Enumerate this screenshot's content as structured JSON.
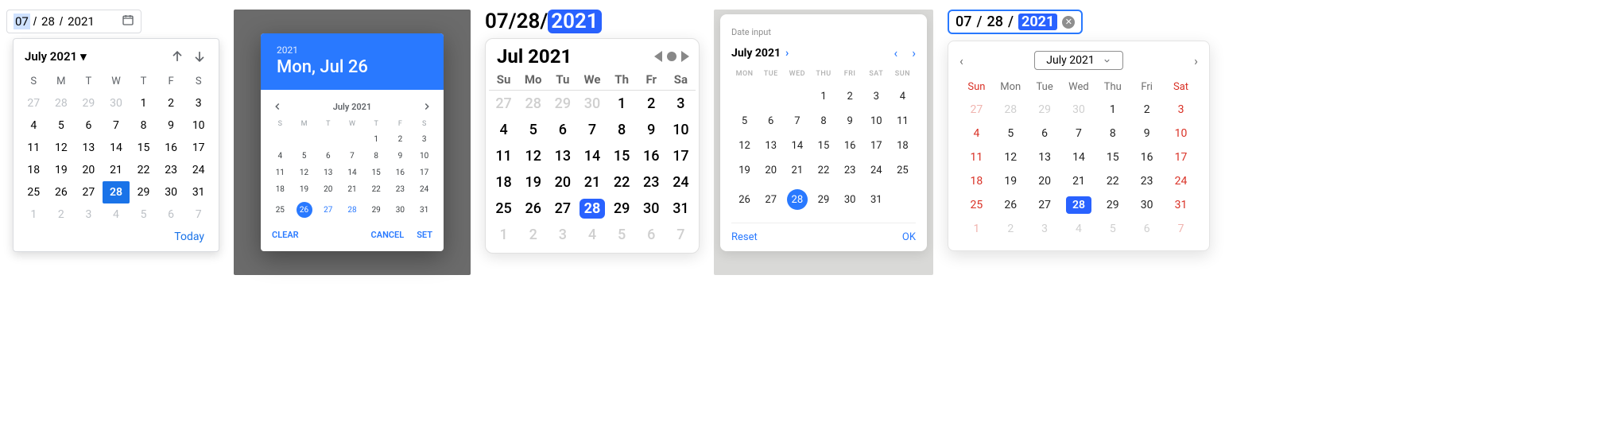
{
  "p1": {
    "input": {
      "mm": "07",
      "dd": "28",
      "yyyy": "2021"
    },
    "title": "July 2021",
    "dow": [
      "S",
      "M",
      "T",
      "W",
      "T",
      "F",
      "S"
    ],
    "weeks": [
      [
        {
          "n": 27,
          "out": true
        },
        {
          "n": 28,
          "out": true
        },
        {
          "n": 29,
          "out": true
        },
        {
          "n": 30,
          "out": true
        },
        {
          "n": 1
        },
        {
          "n": 2
        },
        {
          "n": 3
        }
      ],
      [
        {
          "n": 4
        },
        {
          "n": 5
        },
        {
          "n": 6
        },
        {
          "n": 7
        },
        {
          "n": 8
        },
        {
          "n": 9
        },
        {
          "n": 10
        }
      ],
      [
        {
          "n": 11
        },
        {
          "n": 12
        },
        {
          "n": 13
        },
        {
          "n": 14
        },
        {
          "n": 15
        },
        {
          "n": 16
        },
        {
          "n": 17
        }
      ],
      [
        {
          "n": 18
        },
        {
          "n": 19
        },
        {
          "n": 20
        },
        {
          "n": 21
        },
        {
          "n": 22
        },
        {
          "n": 23
        },
        {
          "n": 24
        }
      ],
      [
        {
          "n": 25
        },
        {
          "n": 26
        },
        {
          "n": 27
        },
        {
          "n": 28,
          "sel": true
        },
        {
          "n": 29
        },
        {
          "n": 30
        },
        {
          "n": 31
        }
      ],
      [
        {
          "n": 1,
          "out": true
        },
        {
          "n": 2,
          "out": true
        },
        {
          "n": 3,
          "out": true
        },
        {
          "n": 4,
          "out": true
        },
        {
          "n": 5,
          "out": true
        },
        {
          "n": 6,
          "out": true
        },
        {
          "n": 7,
          "out": true
        }
      ]
    ],
    "today": "Today"
  },
  "p2": {
    "year": "2021",
    "date": "Mon, Jul 26",
    "month": "July 2021",
    "dow": [
      "S",
      "M",
      "T",
      "W",
      "T",
      "F",
      "S"
    ],
    "weeks": [
      [
        {
          "n": ""
        },
        {
          "n": ""
        },
        {
          "n": ""
        },
        {
          "n": ""
        },
        {
          "n": 1
        },
        {
          "n": 2
        },
        {
          "n": 3
        }
      ],
      [
        {
          "n": 4
        },
        {
          "n": 5
        },
        {
          "n": 6
        },
        {
          "n": 7
        },
        {
          "n": 8
        },
        {
          "n": 9
        },
        {
          "n": 10
        }
      ],
      [
        {
          "n": 11
        },
        {
          "n": 12
        },
        {
          "n": 13
        },
        {
          "n": 14
        },
        {
          "n": 15
        },
        {
          "n": 16
        },
        {
          "n": 17
        }
      ],
      [
        {
          "n": 18
        },
        {
          "n": 19
        },
        {
          "n": 20
        },
        {
          "n": 21
        },
        {
          "n": 22
        },
        {
          "n": 23
        },
        {
          "n": 24
        }
      ],
      [
        {
          "n": 25
        },
        {
          "n": 26,
          "sel": true
        },
        {
          "n": 27,
          "link": true
        },
        {
          "n": 28,
          "link": true
        },
        {
          "n": 29
        },
        {
          "n": 30
        },
        {
          "n": 31
        }
      ]
    ],
    "actions": {
      "clear": "CLEAR",
      "cancel": "CANCEL",
      "set": "SET"
    }
  },
  "p3": {
    "input": {
      "mm": "07",
      "dd": "28",
      "yyyy": "2021"
    },
    "title": "Jul 2021",
    "dow": [
      "Su",
      "Mo",
      "Tu",
      "We",
      "Th",
      "Fr",
      "Sa"
    ],
    "weeks": [
      [
        {
          "n": 27,
          "out": true
        },
        {
          "n": 28,
          "out": true
        },
        {
          "n": 29,
          "out": true
        },
        {
          "n": 30,
          "out": true
        },
        {
          "n": 1
        },
        {
          "n": 2
        },
        {
          "n": 3
        }
      ],
      [
        {
          "n": 4
        },
        {
          "n": 5
        },
        {
          "n": 6
        },
        {
          "n": 7
        },
        {
          "n": 8
        },
        {
          "n": 9
        },
        {
          "n": 10
        }
      ],
      [
        {
          "n": 11
        },
        {
          "n": 12
        },
        {
          "n": 13
        },
        {
          "n": 14
        },
        {
          "n": 15
        },
        {
          "n": 16
        },
        {
          "n": 17
        }
      ],
      [
        {
          "n": 18
        },
        {
          "n": 19
        },
        {
          "n": 20
        },
        {
          "n": 21
        },
        {
          "n": 22
        },
        {
          "n": 23
        },
        {
          "n": 24
        }
      ],
      [
        {
          "n": 25
        },
        {
          "n": 26
        },
        {
          "n": 27
        },
        {
          "n": 28,
          "sel": true
        },
        {
          "n": 29
        },
        {
          "n": 30
        },
        {
          "n": 31
        }
      ],
      [
        {
          "n": 1,
          "out": true
        },
        {
          "n": 2,
          "out": true
        },
        {
          "n": 3,
          "out": true
        },
        {
          "n": 4,
          "out": true
        },
        {
          "n": 5,
          "out": true
        },
        {
          "n": 6,
          "out": true
        },
        {
          "n": 7,
          "out": true
        }
      ]
    ]
  },
  "p4": {
    "label": "Date input",
    "title": "July 2021",
    "dow": [
      "MON",
      "TUE",
      "WED",
      "THU",
      "FRI",
      "SAT",
      "SUN"
    ],
    "weeks": [
      [
        {
          "n": ""
        },
        {
          "n": ""
        },
        {
          "n": ""
        },
        {
          "n": 1
        },
        {
          "n": 2
        },
        {
          "n": 3
        },
        {
          "n": 4
        }
      ],
      [
        {
          "n": 5
        },
        {
          "n": 6
        },
        {
          "n": 7
        },
        {
          "n": 8
        },
        {
          "n": 9
        },
        {
          "n": 10
        },
        {
          "n": 11
        }
      ],
      [
        {
          "n": 12
        },
        {
          "n": 13
        },
        {
          "n": 14
        },
        {
          "n": 15
        },
        {
          "n": 16
        },
        {
          "n": 17
        },
        {
          "n": 18
        }
      ],
      [
        {
          "n": 19
        },
        {
          "n": 20
        },
        {
          "n": 21
        },
        {
          "n": 22
        },
        {
          "n": 23
        },
        {
          "n": 24
        },
        {
          "n": 25
        }
      ],
      [
        {
          "n": 26
        },
        {
          "n": 27
        },
        {
          "n": 28,
          "sel": true
        },
        {
          "n": 29
        },
        {
          "n": 30
        },
        {
          "n": 31
        },
        {
          "n": ""
        }
      ]
    ],
    "actions": {
      "reset": "Reset",
      "ok": "OK"
    }
  },
  "p5": {
    "input": {
      "mm": "07",
      "dd": "28",
      "yyyy": "2021"
    },
    "title": "July 2021",
    "dow": [
      "Sun",
      "Mon",
      "Tue",
      "Wed",
      "Thu",
      "Fri",
      "Sat"
    ],
    "weeks": [
      [
        {
          "n": 27,
          "out": true,
          "off": true
        },
        {
          "n": 28,
          "out": true
        },
        {
          "n": 29,
          "out": true
        },
        {
          "n": 30,
          "out": true
        },
        {
          "n": 1
        },
        {
          "n": 2
        },
        {
          "n": 3,
          "off": true
        }
      ],
      [
        {
          "n": 4,
          "off": true
        },
        {
          "n": 5
        },
        {
          "n": 6
        },
        {
          "n": 7
        },
        {
          "n": 8
        },
        {
          "n": 9
        },
        {
          "n": 10,
          "off": true
        }
      ],
      [
        {
          "n": 11,
          "off": true
        },
        {
          "n": 12
        },
        {
          "n": 13
        },
        {
          "n": 14
        },
        {
          "n": 15
        },
        {
          "n": 16
        },
        {
          "n": 17,
          "off": true
        }
      ],
      [
        {
          "n": 18,
          "off": true
        },
        {
          "n": 19
        },
        {
          "n": 20
        },
        {
          "n": 21
        },
        {
          "n": 22
        },
        {
          "n": 23
        },
        {
          "n": 24,
          "off": true
        }
      ],
      [
        {
          "n": 25,
          "off": true
        },
        {
          "n": 26
        },
        {
          "n": 27
        },
        {
          "n": 28,
          "sel": true
        },
        {
          "n": 29
        },
        {
          "n": 30
        },
        {
          "n": 31,
          "off": true
        }
      ],
      [
        {
          "n": 1,
          "out": true,
          "off": true
        },
        {
          "n": 2,
          "out": true
        },
        {
          "n": 3,
          "out": true
        },
        {
          "n": 4,
          "out": true
        },
        {
          "n": 5,
          "out": true
        },
        {
          "n": 6,
          "out": true
        },
        {
          "n": 7,
          "out": true,
          "off": true
        }
      ]
    ]
  }
}
